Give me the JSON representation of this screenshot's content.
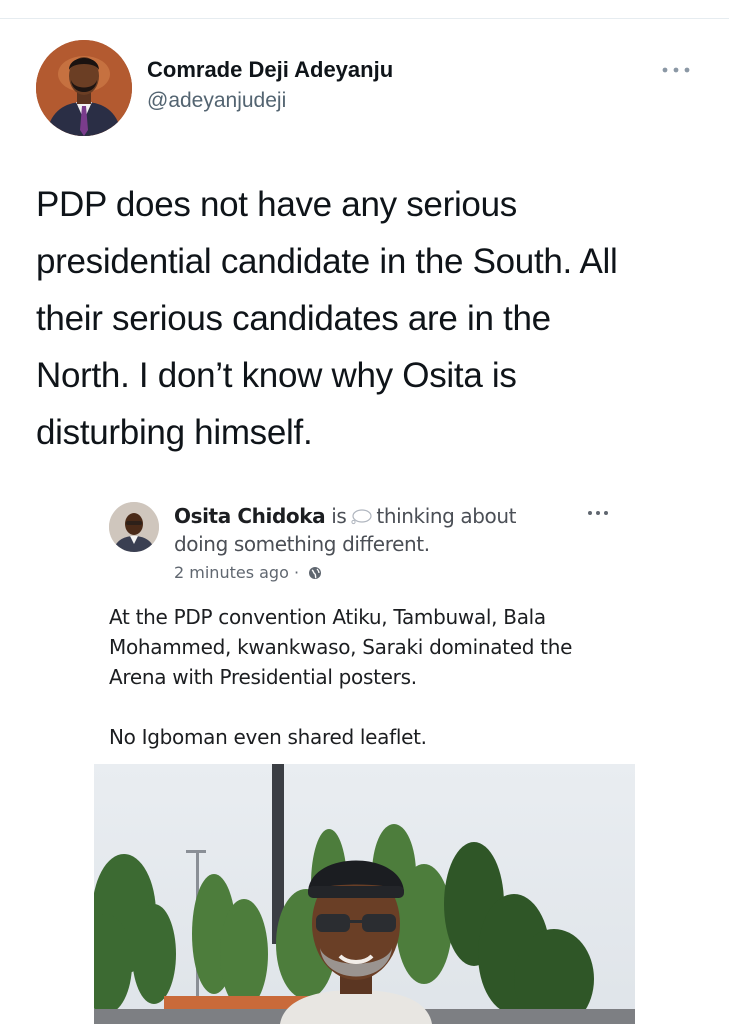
{
  "tweet": {
    "author": {
      "display_name": "Comrade Deji Adeyanju",
      "handle": "@adeyanjudeji"
    },
    "more_icon": "more-horizontal-icon",
    "text_lines": [
      "PDP does not have any serious",
      "presidential candidate in the South. All",
      "their serious candidates are in the",
      "North. I don’t know why Osita is",
      "disturbing himself."
    ]
  },
  "embedded_post": {
    "author_name": "Osita Chidoka",
    "status_line1": "is",
    "status_activity": "thinking about",
    "status_line2": "doing something different.",
    "time": "2 minutes ago",
    "separator": "·",
    "privacy_icon": "globe-icon",
    "more_icon": "more-horizontal-icon",
    "body_lines": [
      "At the PDP convention Atiku, Tambuwal, Bala",
      "Mohammed, kwankwaso, Saraki dominated the",
      "Arena with Presidential posters."
    ],
    "body_line_final": "No Igboman even shared leaflet."
  },
  "colors": {
    "text_primary": "#0f1419",
    "text_secondary": "#536471",
    "fb_text": "#1c1e21",
    "fb_meta": "#606770"
  }
}
